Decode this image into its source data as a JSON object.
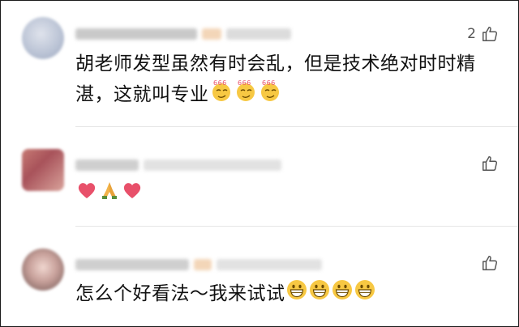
{
  "comments": [
    {
      "likes": "2",
      "text": "胡老师发型虽然有时会乱，但是技术绝对时时精湛，这就叫专业",
      "emojis": [
        "smirk-666-emoji",
        "smirk-666-emoji",
        "smirk-666-emoji"
      ]
    },
    {
      "likes": "",
      "text": "",
      "emojis": [
        "red-heart-emoji",
        "praying-hands-emoji",
        "red-heart-emoji"
      ]
    },
    {
      "likes": "",
      "text": "怎么个好看法～我来试试",
      "emojis": [
        "grinning-face-emoji",
        "grinning-face-emoji",
        "grinning-face-emoji",
        "grinning-face-emoji"
      ]
    }
  ],
  "colors": {
    "text": "#111111",
    "meta_gray": "#555555",
    "divider": "#e6e6e6",
    "emoji_yellow": "#f7c843",
    "heart_red": "#e8506a"
  }
}
